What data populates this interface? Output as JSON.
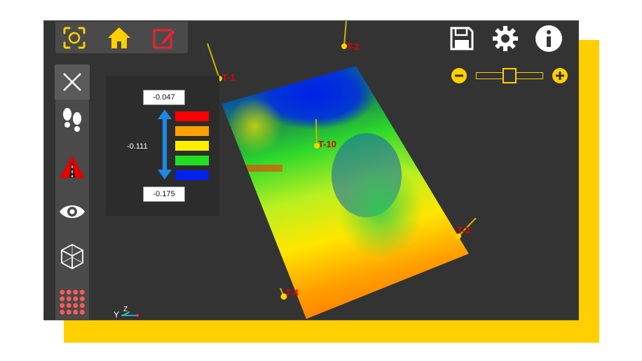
{
  "legend": {
    "max_value": "-0.047",
    "mid_value": "-0.111",
    "min_value": "-0.175",
    "swatches": [
      "#ff0000",
      "#ffa000",
      "#ffee00",
      "#22dd22",
      "#0022ee"
    ]
  },
  "points": [
    {
      "label": "T-1"
    },
    {
      "label": "T-2"
    },
    {
      "label": "T-10"
    },
    {
      "label": "T-3"
    },
    {
      "label": "T-4"
    }
  ],
  "axes": {
    "y": "Y",
    "z": "Z"
  },
  "colors": {
    "accent": "#ffcf00",
    "panel": "#4a4a4a",
    "canvas": "#333333",
    "marker_label": "#e60000"
  },
  "icons": {
    "top": [
      "camera-focus-icon",
      "home-icon",
      "edit-icon"
    ],
    "left": [
      "close-icon",
      "footsteps-icon",
      "warning-road-icon",
      "eye-icon",
      "cube-icon",
      "grid-dots-icon"
    ],
    "right": [
      "save-icon",
      "gear-icon",
      "info-icon"
    ]
  },
  "zoom": {
    "level_fraction": 0.5
  }
}
